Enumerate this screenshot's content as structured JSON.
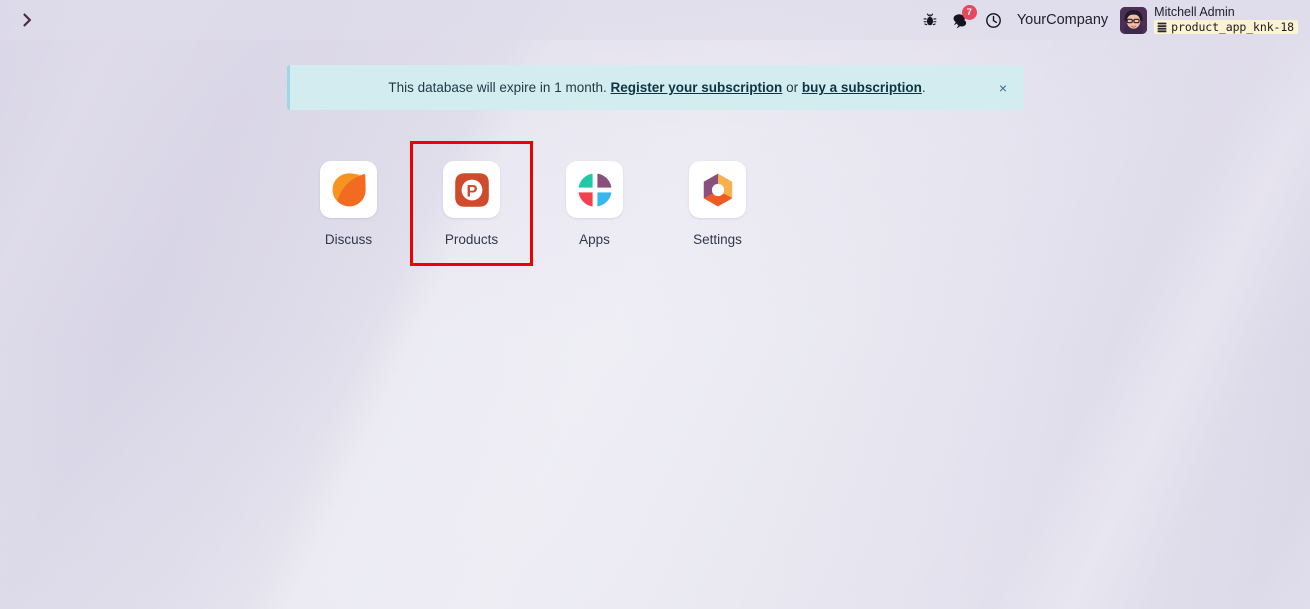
{
  "navbar": {
    "menu_toggle_icon": "chevron-right-icon",
    "icons": [
      {
        "name": "bug-icon",
        "label": "Debug"
      },
      {
        "name": "messages-icon",
        "label": "Messages",
        "badge": "7"
      },
      {
        "name": "activities-clock-icon",
        "label": "Activities"
      }
    ],
    "company": "YourCompany",
    "user": {
      "name": "Mitchell Admin",
      "database": "product_app_knk-18",
      "database_icon": "database-icon",
      "avatar_icon": "user-avatar"
    }
  },
  "alert": {
    "text_before": "This database will expire in 1 month.",
    "link_register": "Register your subscription",
    "text_between": "or",
    "link_buy": "buy a subscription",
    "text_after": ".",
    "close_label": "×",
    "background_color": "#d3ecf0",
    "border_color": "#9ed7e4"
  },
  "apps": [
    {
      "label": "Discuss",
      "icon": "discuss-icon",
      "highlighted": false,
      "colors": {
        "primary": "#f99621",
        "secondary": "#f36c21"
      }
    },
    {
      "label": "Products",
      "icon": "products-icon",
      "highlighted": true,
      "colors": {
        "primary": "#cf4b2c",
        "secondary": "#ffffff"
      }
    },
    {
      "label": "Apps",
      "icon": "apps-icon",
      "highlighted": false,
      "colors": {
        "top_left": "#20c9a5",
        "top_right": "#8a4f7d",
        "bottom_left": "#f5414f",
        "bottom_right": "#38b6f1"
      }
    },
    {
      "label": "Settings",
      "icon": "settings-icon",
      "highlighted": false,
      "colors": {
        "left": "#8a4f7d",
        "right": "#f9b04e",
        "bottom": "#ef5b25"
      }
    }
  ],
  "highlight": {
    "color": "#ee0000",
    "target": "Products"
  },
  "background": {
    "base_color": "#dcdae8"
  }
}
